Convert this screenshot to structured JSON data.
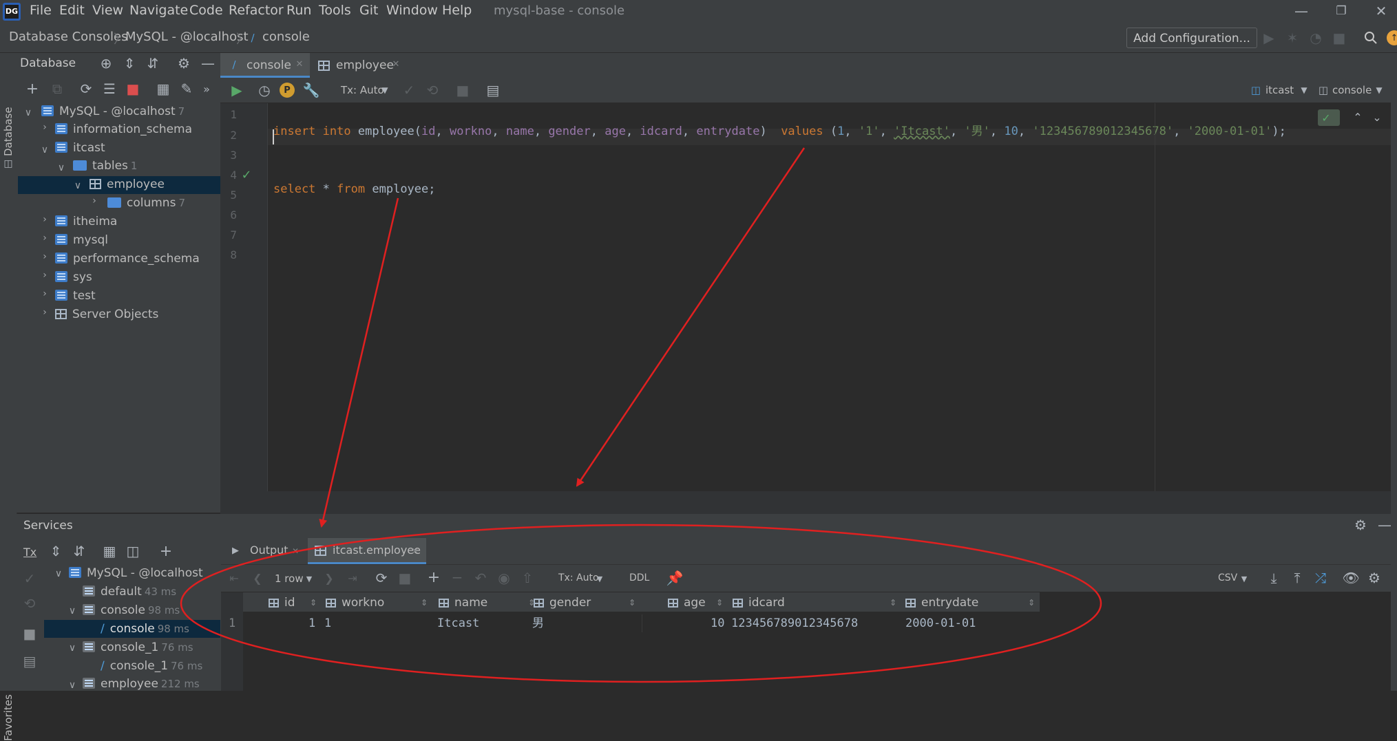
{
  "menubar": {
    "items": [
      "File",
      "Edit",
      "View",
      "Navigate",
      "Code",
      "Refactor",
      "Run",
      "Tools",
      "Git",
      "Window",
      "Help"
    ],
    "window_title": "mysql-base - console",
    "logo_text": "DG"
  },
  "navbar": {
    "crumbs": [
      "Database Consoles",
      "MySQL - @localhost",
      "console"
    ],
    "add_configuration": "Add Configuration..."
  },
  "left_strip": {
    "database_label": "Database",
    "favorites_label": "Favorites"
  },
  "database_panel": {
    "title": "Database",
    "tree": [
      {
        "label": "MySQL - @localhost",
        "count": "7"
      },
      {
        "label": "information_schema"
      },
      {
        "label": "itcast"
      },
      {
        "label": "tables",
        "count": "1"
      },
      {
        "label": "employee"
      },
      {
        "label": "columns",
        "count": "7"
      },
      {
        "label": "itheima"
      },
      {
        "label": "mysql"
      },
      {
        "label": "performance_schema"
      },
      {
        "label": "sys"
      },
      {
        "label": "test"
      },
      {
        "label": "Server Objects"
      }
    ]
  },
  "editor_tabs": [
    {
      "label": "console",
      "active": true
    },
    {
      "label": "employee",
      "active": false
    }
  ],
  "editor_toolbar": {
    "tx_mode": "Tx: Auto",
    "schema": "itcast",
    "session": "console"
  },
  "editor": {
    "line_numbers": [
      "1",
      "2",
      "3",
      "4",
      "5",
      "6",
      "7",
      "8"
    ],
    "line1": {
      "kw_insert": "insert",
      "kw_into": "into",
      "table": "employee(",
      "cols": [
        "id",
        "workno",
        "name",
        "gender",
        "age",
        "idcard",
        "entrydate"
      ],
      "close": ")",
      "kw_values": "values",
      "open": "(",
      "v_id": "1",
      "v_workno": "'1'",
      "v_name": "'Itcast'",
      "v_gender": "'男'",
      "v_age": "10",
      "v_idcard": "'123456789012345678'",
      "v_date": "'2000-01-01'",
      "tail": ");"
    },
    "line4": {
      "kw_select": "select",
      "star": "*",
      "kw_from": "from",
      "table": "employee;"
    }
  },
  "services": {
    "title": "Services",
    "tx_label": "Tx",
    "tree": [
      {
        "label": "MySQL - @localhost",
        "time": ""
      },
      {
        "label": "default",
        "time": "43 ms"
      },
      {
        "label": "console",
        "time": "98 ms"
      },
      {
        "label": "console",
        "time": "98 ms"
      },
      {
        "label": "console_1",
        "time": "76 ms"
      },
      {
        "label": "console_1",
        "time": "76 ms"
      },
      {
        "label": "employee",
        "time": "212 ms"
      }
    ],
    "tabs": [
      {
        "label": "Output"
      },
      {
        "label": "itcast.employee"
      }
    ],
    "result_toolbar": {
      "rows": "1 row",
      "tx_mode": "Tx: Auto",
      "ddl": "DDL",
      "export_format": "CSV"
    },
    "table": {
      "columns": [
        "id",
        "workno",
        "name",
        "gender",
        "age",
        "idcard",
        "entrydate"
      ],
      "rows": [
        {
          "num": "1",
          "id": "1",
          "workno": "1",
          "name": "Itcast",
          "gender": "男",
          "age": "10",
          "idcard": "123456789012345678",
          "entrydate": "2000-01-01"
        }
      ]
    }
  },
  "colors": {
    "annotation_red": "#e02020",
    "selection": "#0d293e",
    "keyword": "#cc7832",
    "string": "#6a8759",
    "number": "#6897bb"
  }
}
